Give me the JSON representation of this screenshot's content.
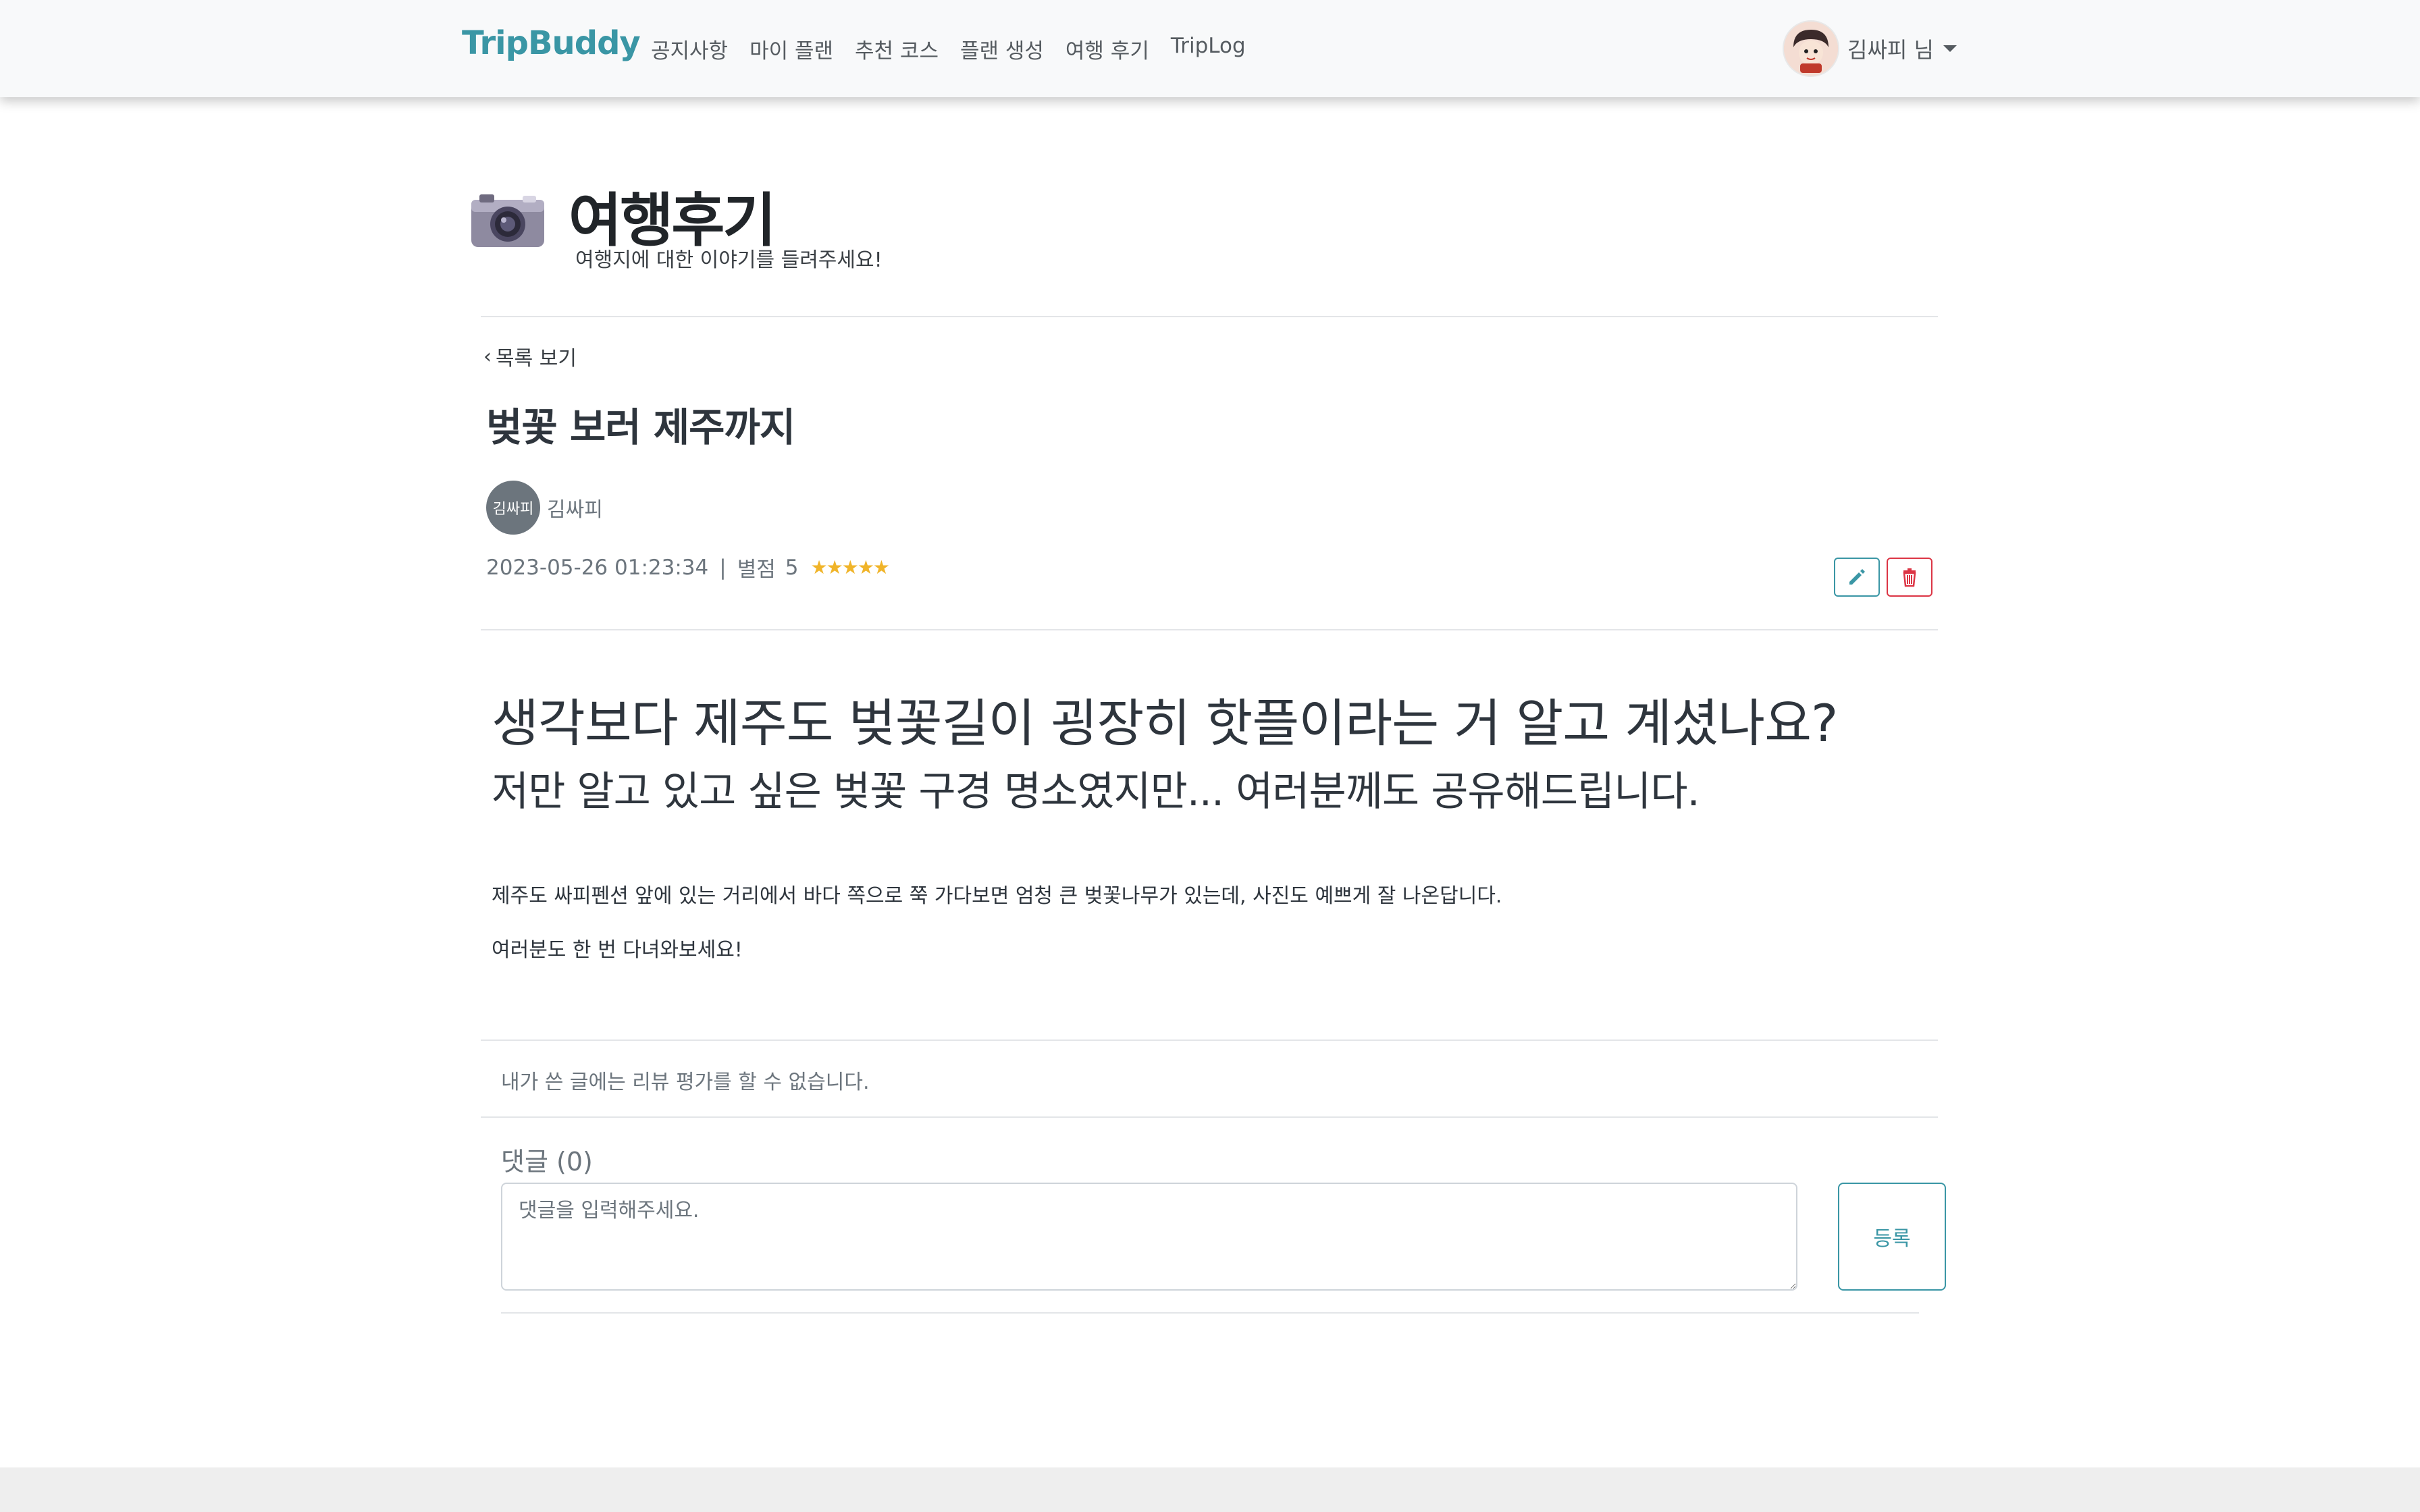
{
  "navbar": {
    "brand": "TripBuddy",
    "links": [
      "공지사항",
      "마이 플랜",
      "추천 코스",
      "플랜 생성",
      "여행 후기",
      "TripLog"
    ],
    "user_label": "김싸피 님"
  },
  "header": {
    "title": "여행후기",
    "subtitle": "여행지에 대한 이야기를 들려주세요!"
  },
  "post": {
    "back_label": "목록 보기",
    "title": "벚꽃 보러 제주까지",
    "author_avatar_text": "김싸피",
    "author_name": "김싸피",
    "datetime": "2023-05-26 01:23:34",
    "separator": "|",
    "rating_label": "별점",
    "rating_value": "5",
    "stars": 5,
    "content": {
      "heading1": "생각보다 제주도 벚꽃길이 굉장히 핫플이라는 거 알고 계셨나요?",
      "heading2": "저만 알고 있고 싶은 벚꽃 구경 명소였지만... 여러분께도 공유해드립니다.",
      "paragraph1": "제주도 싸피펜션 앞에 있는 거리에서 바다 쪽으로 쭉 가다보면 엄청 큰 벚꽃나무가 있는데, 사진도 예쁘게 잘 나온답니다.",
      "paragraph2": "여러분도 한 번 다녀와보세요!"
    }
  },
  "review_notice": "내가 쓴 글에는 리뷰 평가를 할 수 없습니다.",
  "comments": {
    "heading": "댓글 (0)",
    "placeholder": "댓글을 입력해주세요.",
    "submit_label": "등록"
  },
  "colors": {
    "brand": "#3a96a5",
    "danger": "#dc3545",
    "star": "#f0b429"
  }
}
